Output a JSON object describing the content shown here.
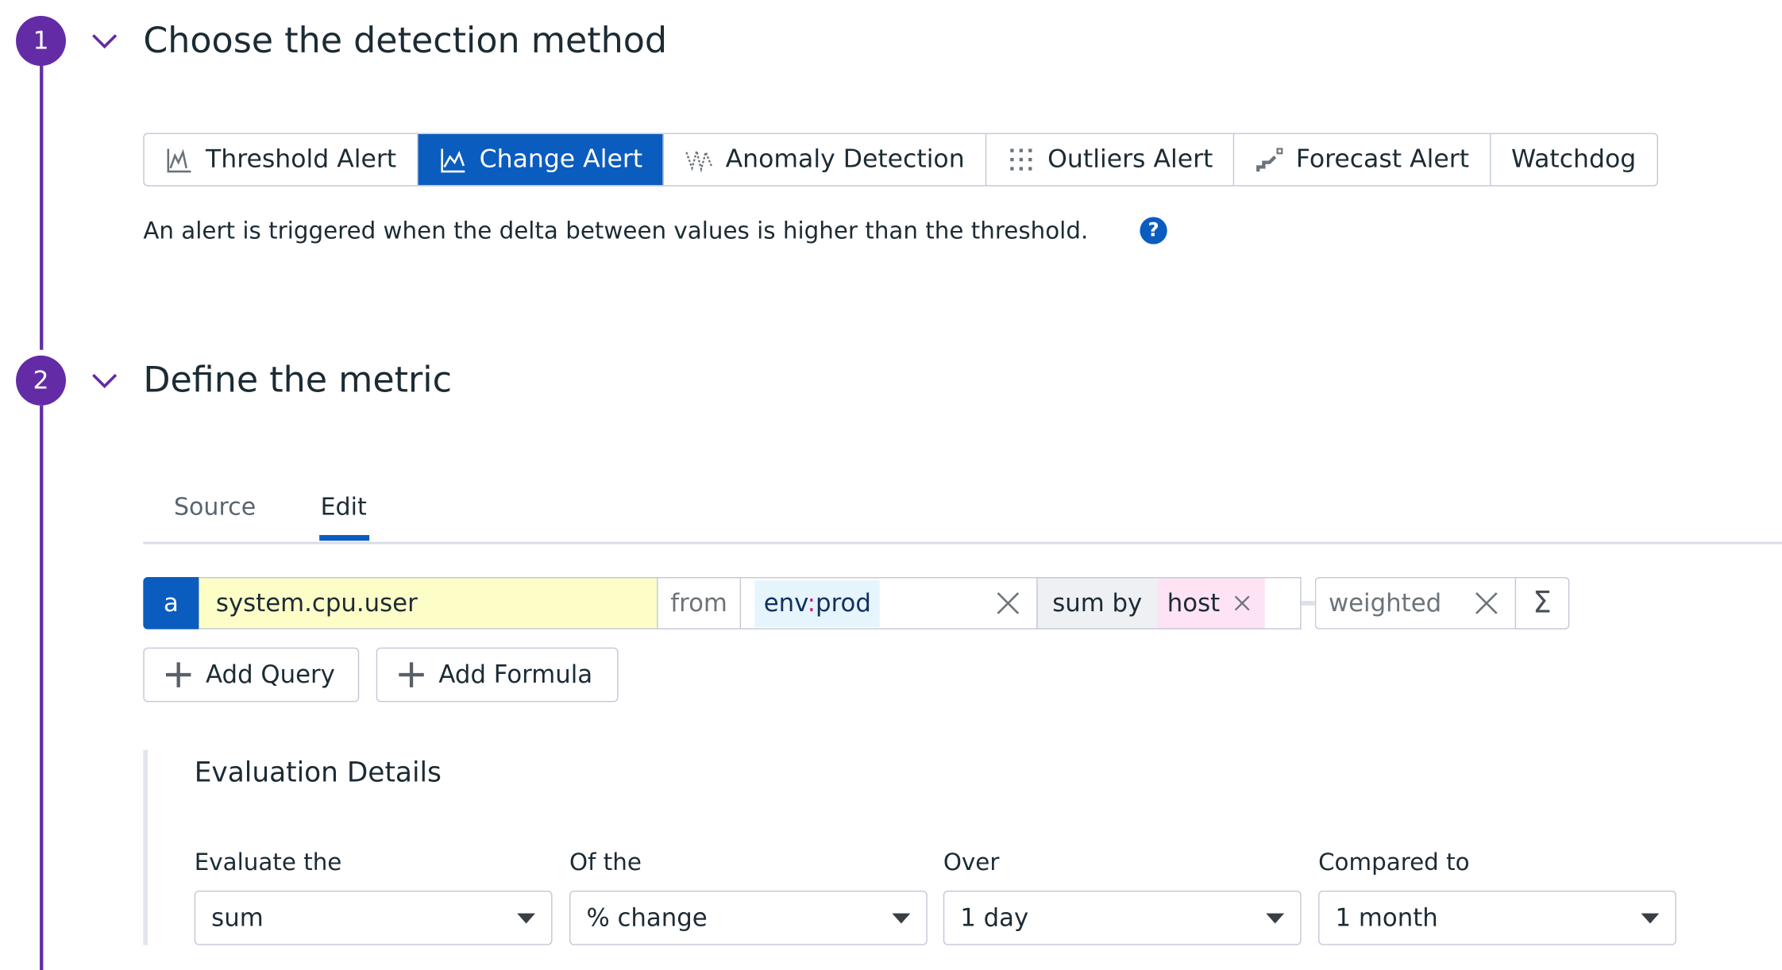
{
  "steps": [
    {
      "number": "1",
      "title": "Choose the detection method"
    },
    {
      "number": "2",
      "title": "Define the metric"
    }
  ],
  "detection_methods": [
    {
      "label": "Threshold Alert",
      "icon": "threshold-icon",
      "active": false
    },
    {
      "label": "Change Alert",
      "icon": "change-icon",
      "active": true
    },
    {
      "label": "Anomaly Detection",
      "icon": "anomaly-icon",
      "active": false
    },
    {
      "label": "Outliers Alert",
      "icon": "outliers-icon",
      "active": false
    },
    {
      "label": "Forecast Alert",
      "icon": "forecast-icon",
      "active": false
    },
    {
      "label": "Watchdog",
      "icon": null,
      "active": false
    }
  ],
  "description": "An alert is triggered when the delta between values is higher than the threshold.",
  "help_icon": "?",
  "tabs": [
    {
      "label": "Source"
    },
    {
      "label": "Edit",
      "active": true
    }
  ],
  "query": {
    "letter": "a",
    "metric": "system.cpu.user",
    "from_label": "from",
    "tag_key": "env",
    "tag_sep": ":",
    "tag_value": "prod",
    "agg_label": "sum by",
    "group": "host",
    "weighted": "weighted",
    "sigma": "Σ"
  },
  "buttons": {
    "add_query": "Add Query",
    "add_formula": "Add Formula"
  },
  "evaluation": {
    "title": "Evaluation Details",
    "fields": [
      {
        "label": "Evaluate the",
        "value": "sum"
      },
      {
        "label": "Of the",
        "value": "% change"
      },
      {
        "label": "Over",
        "value": "1 day"
      },
      {
        "label": "Compared to",
        "value": "1 month"
      }
    ]
  },
  "colors": {
    "step": "#632ca6",
    "accent": "#0b5cbf",
    "metric_bg": "#fdfdc8",
    "tag_bg": "#e6f4fc",
    "group_bg": "#fde3f4",
    "agg_bg": "#eef0f4"
  }
}
